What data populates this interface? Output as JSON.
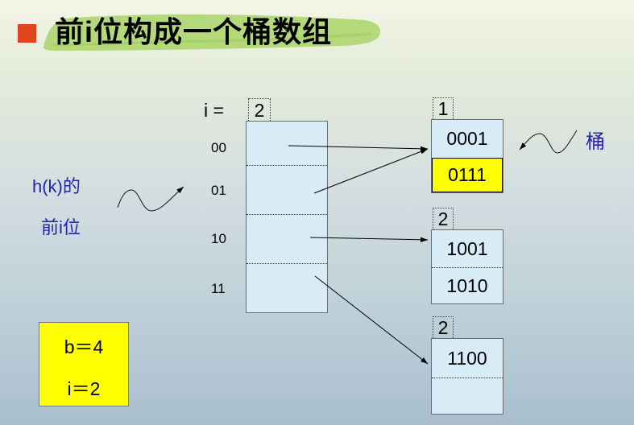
{
  "slide": {
    "title": "前i位构成一个桶数组",
    "colors": {
      "bullet": "#e2431f",
      "title_highlight": "#b3d97a",
      "cell_fill": "#d8ecf8",
      "highlight_fill": "#ffff00",
      "note_text": "#2424a6"
    }
  },
  "directory": {
    "i_label": "i =",
    "global_depth": "2",
    "entries": [
      {
        "prefix": "00",
        "bucket": 0
      },
      {
        "prefix": "01",
        "bucket": 0
      },
      {
        "prefix": "10",
        "bucket": 1
      },
      {
        "prefix": "11",
        "bucket": 2
      }
    ]
  },
  "annotations": {
    "hash_prefix_line1": "h(k)的",
    "hash_prefix_line2": "前i位",
    "bucket": "桶"
  },
  "buckets": [
    {
      "local_depth": "1",
      "records": [
        "0001",
        "0111"
      ],
      "highlighted_record": 1
    },
    {
      "local_depth": "2",
      "records": [
        "1001",
        "1010"
      ]
    },
    {
      "local_depth": "2",
      "records": [
        "1100"
      ]
    }
  ],
  "parameters": {
    "b": "b＝4",
    "i": "i＝2"
  }
}
